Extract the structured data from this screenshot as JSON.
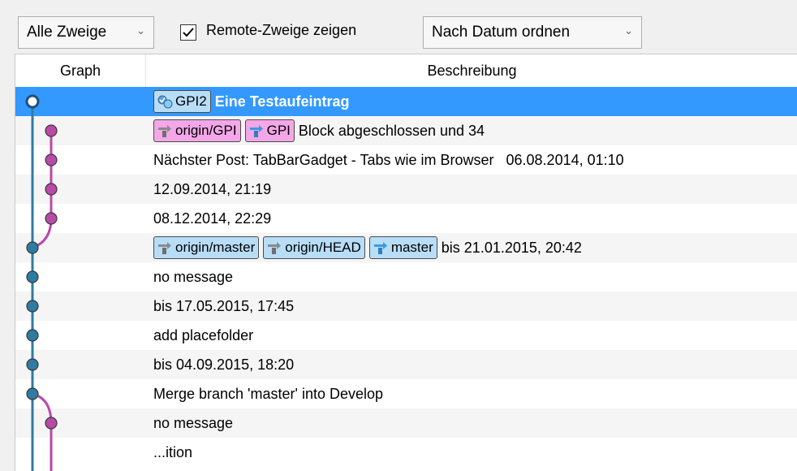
{
  "toolbar": {
    "branch_select": "Alle Zweige",
    "remote_checkbox_label": "Remote-Zweige zeigen",
    "remote_checked": true,
    "sort_select": "Nach Datum ordnen"
  },
  "columns": {
    "graph": "Graph",
    "description": "Beschreibung"
  },
  "colors": {
    "selection": "#3399ff",
    "main_line": "#2e7ba3",
    "branch_line": "#b84aa8",
    "badge_blue": "#b8ddf7",
    "badge_pink": "#f4a7e8"
  },
  "rows": [
    {
      "badges": [
        {
          "label": "GPI2",
          "style": "blue",
          "icon": "current-branch-icon"
        }
      ],
      "text": "Eine Testaufeintrag",
      "selected": true
    },
    {
      "badges": [
        {
          "label": "origin/GPI",
          "style": "pink",
          "icon": "remote-branch-icon"
        },
        {
          "label": "GPI",
          "style": "pink",
          "icon": "local-branch-icon"
        }
      ],
      "text": "Block abgeschlossen und 34"
    },
    {
      "badges": [],
      "text": "Nächster Post: TabBarGadget - Tabs wie im Browser   06.08.2014, 01:10"
    },
    {
      "badges": [],
      "text": "12.09.2014, 21:19"
    },
    {
      "badges": [],
      "text": "08.12.2014, 22:29"
    },
    {
      "badges": [
        {
          "label": "origin/master",
          "style": "blue",
          "icon": "remote-branch-icon"
        },
        {
          "label": "origin/HEAD",
          "style": "blue",
          "icon": "remote-branch-icon"
        },
        {
          "label": "master",
          "style": "blue",
          "icon": "local-branch-icon"
        }
      ],
      "text": "bis 21.01.2015, 20:42"
    },
    {
      "badges": [],
      "text": "no message"
    },
    {
      "badges": [],
      "text": "bis 17.05.2015, 17:45"
    },
    {
      "badges": [],
      "text": "add placefolder"
    },
    {
      "badges": [],
      "text": "bis 04.09.2015, 18:20"
    },
    {
      "badges": [],
      "text": "Merge branch 'master' into Develop"
    },
    {
      "badges": [],
      "text": "no message"
    },
    {
      "badges": [],
      "text": "...ition"
    }
  ]
}
